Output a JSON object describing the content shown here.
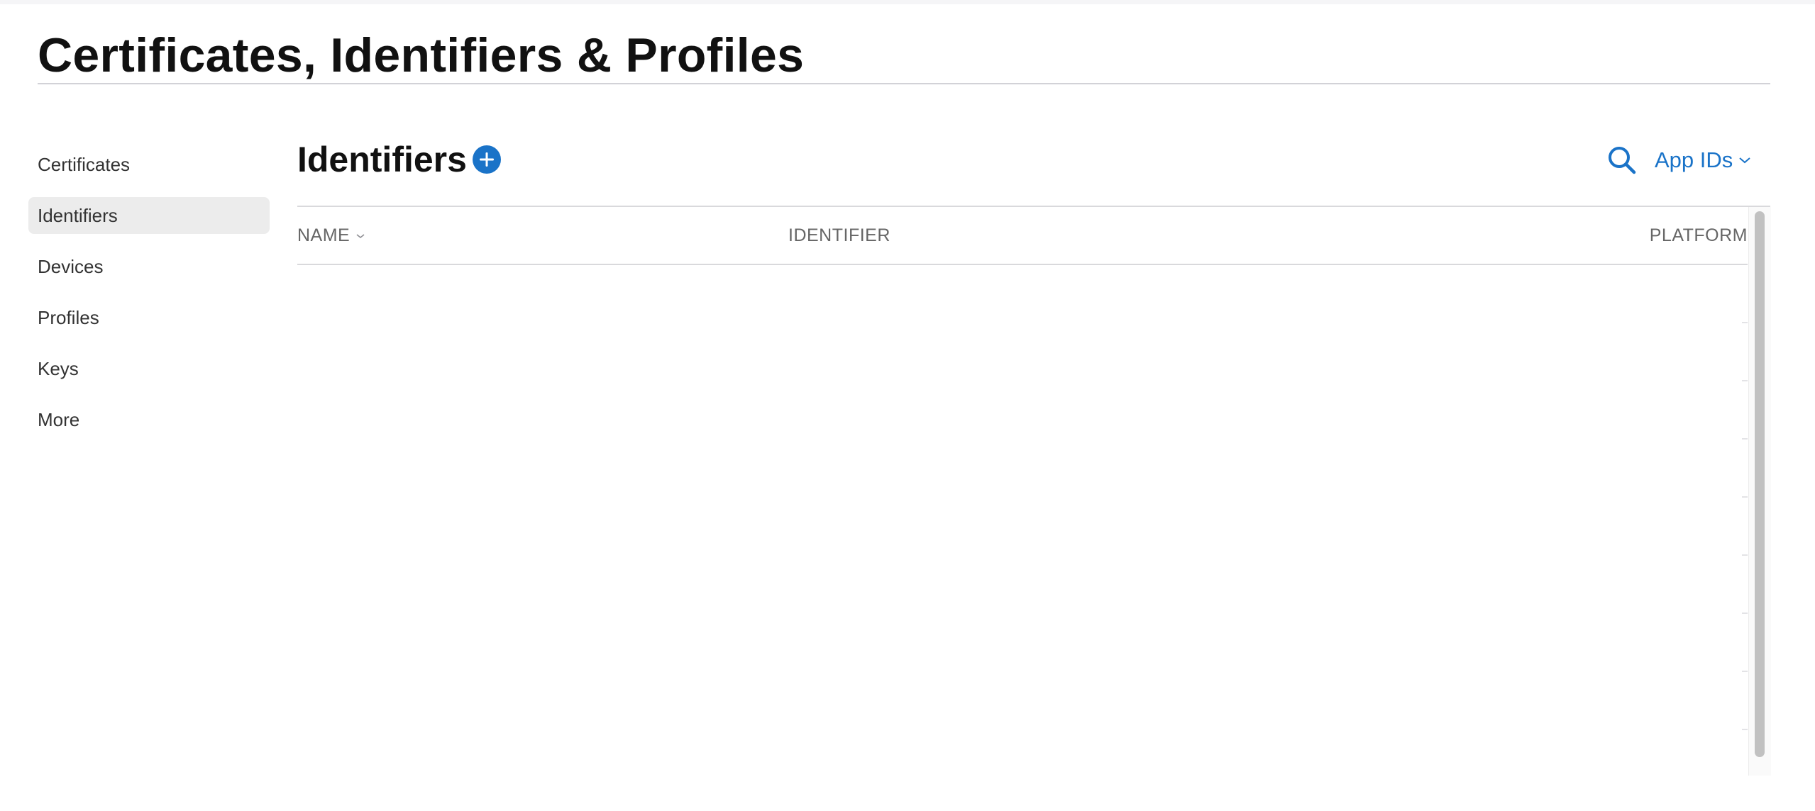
{
  "page": {
    "title": "Certificates, Identifiers & Profiles"
  },
  "sidebar": {
    "items": [
      {
        "label": "Certificates",
        "active": false
      },
      {
        "label": "Identifiers",
        "active": true
      },
      {
        "label": "Devices",
        "active": false
      },
      {
        "label": "Profiles",
        "active": false
      },
      {
        "label": "Keys",
        "active": false
      },
      {
        "label": "More",
        "active": false
      }
    ]
  },
  "main": {
    "section_title": "Identifiers",
    "add_icon": "plus-circle-icon",
    "search_icon": "search-icon",
    "filter": {
      "selected": "App IDs",
      "icon": "chevron-down-icon"
    },
    "table": {
      "columns": {
        "name": "NAME",
        "identifier": "IDENTIFIER",
        "platform": "PLATFORM"
      },
      "sort_icon": "chevron-down-icon",
      "rows": []
    }
  },
  "colors": {
    "accent": "#1a73c8",
    "title_text": "#111111",
    "header_text": "#666666",
    "active_item_bg": "#ececec",
    "divider": "#d9d9dc",
    "scroll_thumb": "#c1c1c1"
  }
}
